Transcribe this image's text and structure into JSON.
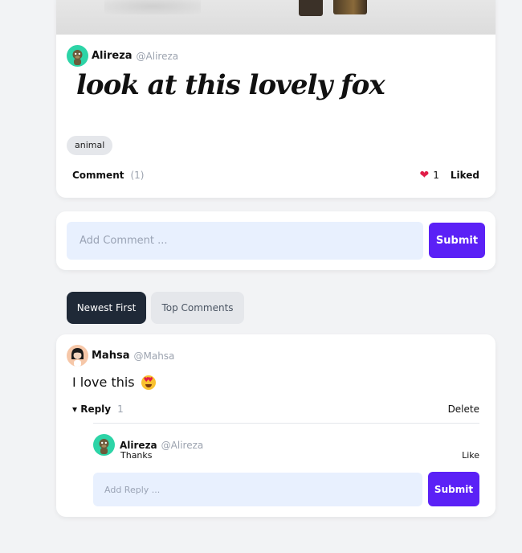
{
  "post": {
    "author": {
      "name": "Alireza",
      "handle": "@Alireza"
    },
    "title": "look at this lovely fox",
    "tag": "animal",
    "comment_label": "Comment",
    "comment_count": "(1)",
    "like_count": "1",
    "liked_label": "Liked"
  },
  "add_comment": {
    "placeholder": "Add Comment ...",
    "submit_label": "Submit"
  },
  "sort_tabs": {
    "newest": "Newest First",
    "top": "Top Comments"
  },
  "comment": {
    "author": {
      "name": "Mahsa",
      "handle": "@Mahsa"
    },
    "text": "I love this",
    "reply_toggle": "▾ Reply",
    "reply_count": "1",
    "delete_label": "Delete",
    "reply": {
      "author": {
        "name": "Alireza",
        "handle": "@Alireza"
      },
      "text": "Thanks",
      "like_label": "Like"
    },
    "reply_input": {
      "placeholder": "Add Reply ...",
      "submit_label": "Submit"
    }
  },
  "colors": {
    "accent": "#5b21f6",
    "active_tab": "#1f2937",
    "input_bg": "#e8f0fe",
    "heart": "#e11d48"
  },
  "icons": {
    "post_avatar": "ape-avatar-icon",
    "comment_avatar": "woman-avatar-icon",
    "like": "heart-icon",
    "comment_emoji": "heart-eyes-emoji-icon"
  }
}
